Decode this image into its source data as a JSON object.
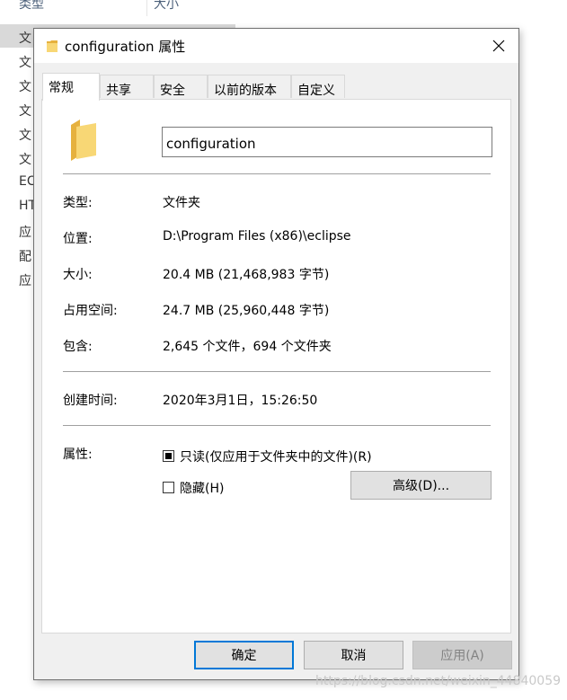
{
  "background_window": {
    "columns": [
      "类型",
      "大小"
    ],
    "items": [
      "文",
      "文",
      "文",
      "文",
      "文",
      "文",
      "EC",
      "HT",
      "应",
      "配",
      "应"
    ]
  },
  "dialog": {
    "title": "configuration 属性",
    "tabs": [
      {
        "label": "常规",
        "active": true
      },
      {
        "label": "共享",
        "active": false
      },
      {
        "label": "安全",
        "active": false
      },
      {
        "label": "以前的版本",
        "active": false
      },
      {
        "label": "自定义",
        "active": false
      }
    ],
    "name_value": "configuration",
    "properties": [
      {
        "label": "类型:",
        "value": "文件夹"
      },
      {
        "label": "位置:",
        "value": "D:\\Program Files (x86)\\eclipse"
      },
      {
        "label": "大小:",
        "value": "20.4 MB (21,468,983 字节)"
      },
      {
        "label": "占用空间:",
        "value": "24.7 MB (25,960,448 字节)"
      },
      {
        "label": "包含:",
        "value": "2,645 个文件，694 个文件夹"
      }
    ],
    "created": {
      "label": "创建时间:",
      "value": "2020年3月1日，15:26:50"
    },
    "attributes": {
      "label": "属性:",
      "readonly": {
        "label": "只读(仅应用于文件夹中的文件)(R)",
        "state": "indeterminate"
      },
      "hidden": {
        "label": "隐藏(H)",
        "state": "unchecked"
      },
      "advanced_button": "高级(D)..."
    },
    "buttons": {
      "ok": "确定",
      "cancel": "取消",
      "apply": "应用(A)"
    },
    "icons": {
      "folder": "folder-icon",
      "close": "close-icon"
    },
    "colors": {
      "folder_yellow": "#f8d775",
      "folder_dark": "#e6b13e",
      "focus_blue": "#0078d7"
    }
  },
  "watermark": "https://blog.csdn.net/weixin_44840059"
}
